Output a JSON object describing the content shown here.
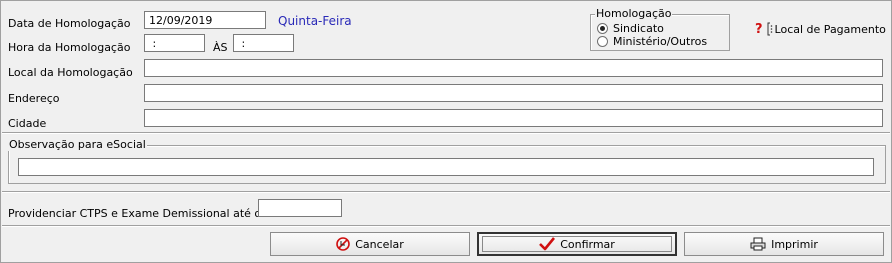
{
  "form": {
    "data_label": "Data de Homologação",
    "data_value": "12/09/2019",
    "weekday": "Quinta-Feira",
    "hora_label": "Hora da Homologação",
    "hora_inicio": " :",
    "as_label": "ÀS",
    "hora_fim": " :",
    "local_label": "Local da Homologação",
    "local_value": "",
    "endereco_label": "Endereço",
    "endereco_value": "",
    "cidade_label": "Cidade",
    "cidade_value": ""
  },
  "homologacao": {
    "title": "Homologação",
    "options": [
      "Sindicato",
      "Ministério/Outros"
    ],
    "selected": "Sindicato"
  },
  "local_pagamento": {
    "icon": "help-question-icon",
    "label": "Local de Pagamento"
  },
  "observacao": {
    "title": "Observação para eSocial",
    "value": ""
  },
  "providenciar": {
    "label": "Providenciar CTPS e Exame Demissional até o dia",
    "value": ""
  },
  "buttons": {
    "cancelar": {
      "label": "Cancelar",
      "icon": "cancel-icon",
      "color": "#d01010"
    },
    "confirmar": {
      "label": "Confirmar",
      "icon": "checkmark-icon",
      "color": "#d01010"
    },
    "imprimir": {
      "label": "Imprimir",
      "icon": "printer-icon"
    }
  },
  "colors": {
    "weekday": "#2a2ab8",
    "question_mark": "#d01010"
  }
}
